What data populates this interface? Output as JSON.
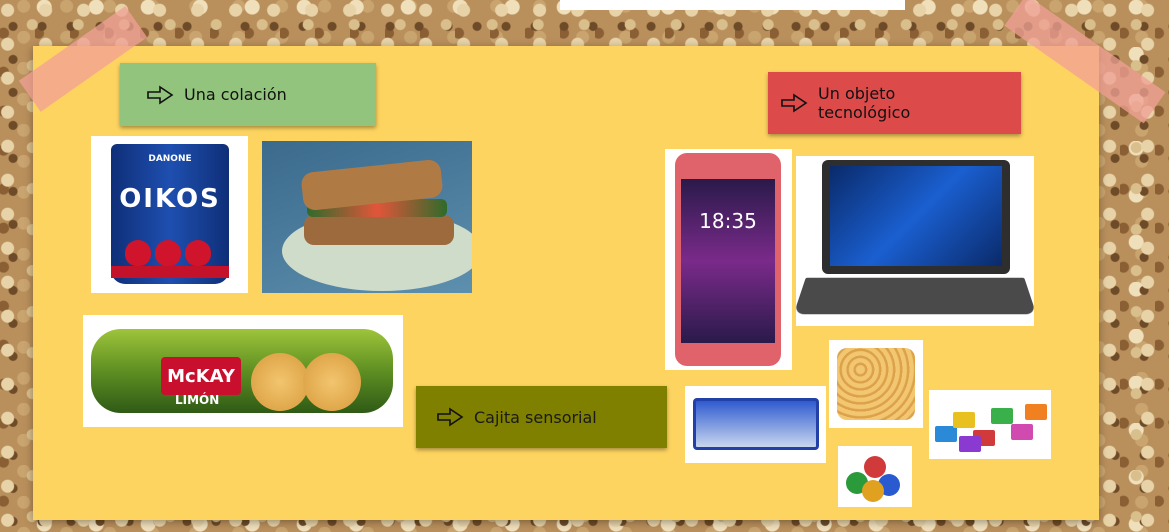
{
  "labels": {
    "colacion": "Una colación",
    "tecnologico_line1": "Un objeto",
    "tecnologico_line2": "tecnológico",
    "sensorial": "Cajita sensorial"
  },
  "photos": {
    "yogurt_brand": "OIKOS",
    "yogurt_maker": "DANONE",
    "cookie_brand": "McKAY",
    "cookie_flavor": "LIMÓN",
    "phone_time": "18:35"
  },
  "colors": {
    "board": "#fed460",
    "label_colacion": "#93c47d",
    "label_tecnologico": "#dc4a4a",
    "label_sensorial": "#7f7f00"
  }
}
